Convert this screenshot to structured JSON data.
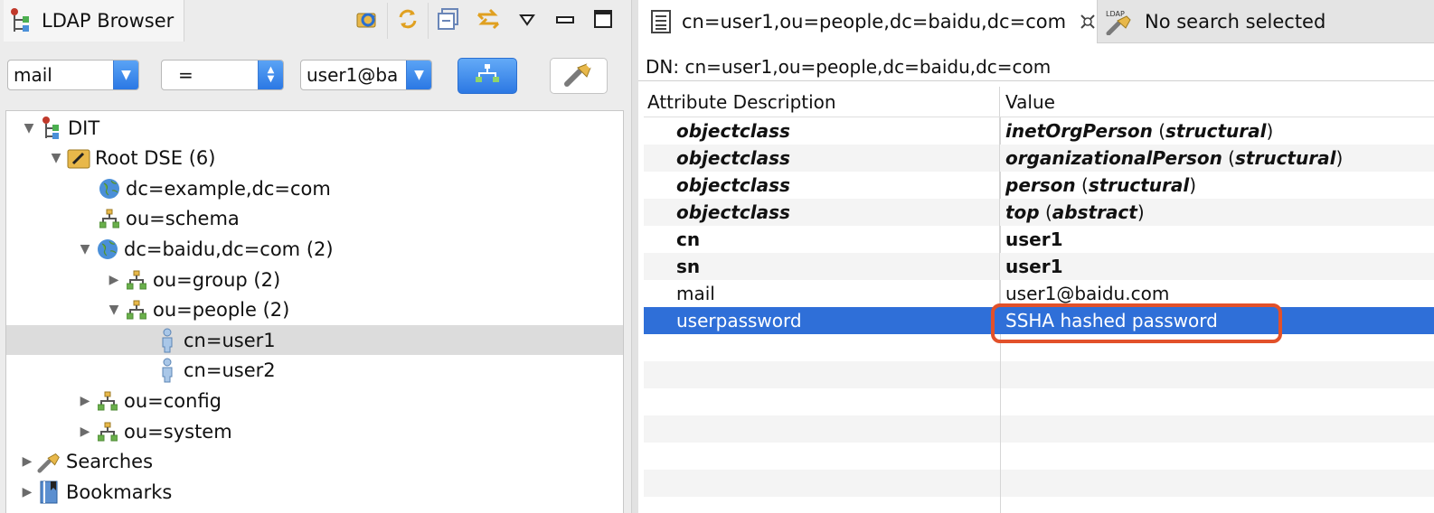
{
  "left_panel": {
    "view_title": "LDAP Browser",
    "filter": {
      "attribute": "mail",
      "operator": "=",
      "value": "user1@ba"
    },
    "tree": [
      {
        "label": "DIT",
        "expanded": true,
        "icon": "dit-icon"
      },
      {
        "label": "Root DSE (6)",
        "expanded": true,
        "icon": "root-dse-icon"
      },
      {
        "label": "dc=example,dc=com",
        "icon": "globe-icon"
      },
      {
        "label": "ou=schema",
        "icon": "ou-icon"
      },
      {
        "label": "dc=baidu,dc=com (2)",
        "expanded": true,
        "icon": "globe-icon"
      },
      {
        "label": "ou=group (2)",
        "expanded": false,
        "icon": "ou-icon"
      },
      {
        "label": "ou=people (2)",
        "expanded": true,
        "icon": "ou-icon"
      },
      {
        "label": "cn=user1",
        "icon": "user-icon",
        "selected": true
      },
      {
        "label": "cn=user2",
        "icon": "user-icon"
      },
      {
        "label": "ou=config",
        "expanded": false,
        "icon": "ou-icon"
      },
      {
        "label": "ou=system",
        "expanded": false,
        "icon": "ou-icon"
      },
      {
        "label": "Searches",
        "expanded": false,
        "icon": "search-icon"
      },
      {
        "label": "Bookmarks",
        "expanded": false,
        "icon": "bookmark-icon"
      }
    ]
  },
  "editor": {
    "tabs": [
      {
        "label": "cn=user1,ou=people,dc=baidu,dc=com",
        "active": true
      },
      {
        "label": "No search selected",
        "active": false
      }
    ],
    "dn": "DN: cn=user1,ou=people,dc=baidu,dc=com",
    "columns": [
      "Attribute Description",
      "Value"
    ],
    "rows": [
      {
        "attr": "objectclass",
        "value": "inetOrgPerson",
        "kind": "structural",
        "style": "objectclass"
      },
      {
        "attr": "objectclass",
        "value": "organizationalPerson",
        "kind": "structural",
        "style": "objectclass"
      },
      {
        "attr": "objectclass",
        "value": "person",
        "kind": "structural",
        "style": "objectclass"
      },
      {
        "attr": "objectclass",
        "value": "top",
        "kind": "abstract",
        "style": "objectclass"
      },
      {
        "attr": "cn",
        "value": "user1",
        "style": "bold"
      },
      {
        "attr": "sn",
        "value": "user1",
        "style": "bold"
      },
      {
        "attr": "mail",
        "value": "user1@baidu.com",
        "style": "normal"
      },
      {
        "attr": "userpassword",
        "value": "SSHA hashed password",
        "style": "selected"
      }
    ]
  },
  "colors": {
    "selection_blue": "#2f6fd8",
    "highlight_border": "#e2512a"
  }
}
